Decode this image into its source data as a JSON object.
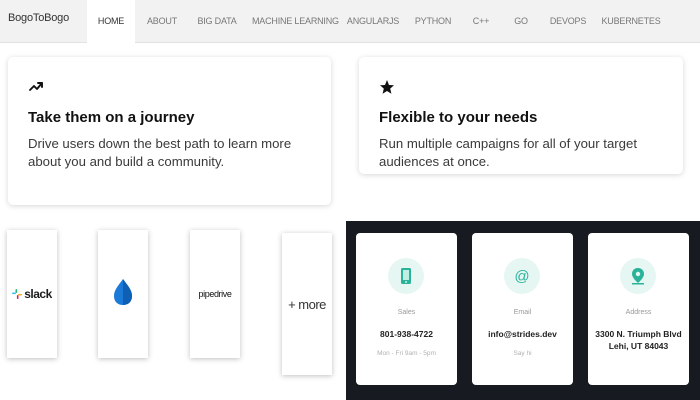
{
  "nav": {
    "brand": "BogoToBogo",
    "items": [
      {
        "label": "HOME",
        "active": true
      },
      {
        "label": "ABOUT"
      },
      {
        "label": "BIG DATA"
      },
      {
        "label": "MACHINE LEARNING"
      },
      {
        "label": "ANGULARJS"
      },
      {
        "label": "PYTHON"
      },
      {
        "label": "C++"
      },
      {
        "label": "GO"
      },
      {
        "label": "DEVOPS"
      },
      {
        "label": "KUBERNETES"
      }
    ]
  },
  "features": [
    {
      "icon": "trending-up-icon",
      "title": "Take them on a journey",
      "description": "Drive users down the best path to learn more about you and build a community."
    },
    {
      "icon": "star-icon",
      "title": "Flexible to your needs",
      "description": "Run multiple campaigns for all of your target audiences at once."
    }
  ],
  "integrations": [
    {
      "name": "slack",
      "label": "slack"
    },
    {
      "name": "onedrive-icon",
      "label": ""
    },
    {
      "name": "pipedrive",
      "label": "pipedrive"
    },
    {
      "name": "more",
      "label": "+ more"
    }
  ],
  "contact": [
    {
      "icon": "phone-icon",
      "label": "Sales",
      "value": "801-938-4722",
      "sub": "Mon - Fri 9am - 5pm"
    },
    {
      "icon": "at-icon",
      "label": "Email",
      "value": "info@strides.dev",
      "sub": "Say hi"
    },
    {
      "icon": "map-pin-icon",
      "label": "Address",
      "value": "3300 N. Triumph Blvd",
      "value2": "Lehi, UT 84043",
      "sub": ""
    }
  ],
  "colors": {
    "nav_bg": "#f2f2f2",
    "contact_bg": "#171a20",
    "accent_teal": "#2bb39a",
    "icon_circle": "#e6f7f3"
  }
}
